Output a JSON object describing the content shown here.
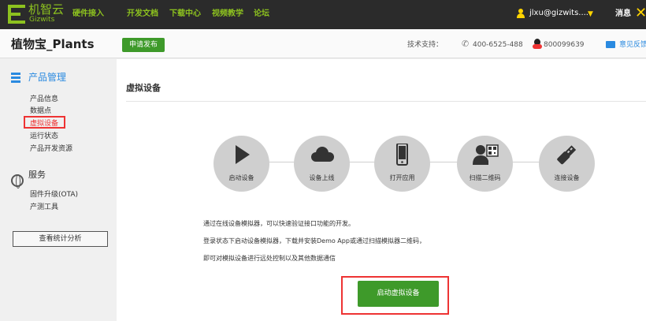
{
  "topbar": {
    "brand_cn": "机智云",
    "brand_en": "Gizwits",
    "nav": [
      "硬件接入",
      "开发文档",
      "下载中心",
      "视频教学",
      "论坛"
    ],
    "user": "jlxu@gizwits....",
    "messages": "消息",
    "accent_color": "#8dc21f"
  },
  "subbar": {
    "product_name": "植物宝_Plants",
    "publish_label": "申请发布",
    "support_label": "技术支持：",
    "phone": "400-6525-488",
    "qq": "800099639",
    "feedback": "意见反馈"
  },
  "sidebar": {
    "section1": "产品管理",
    "items1": [
      "产品信息",
      "数据点",
      "虚拟设备",
      "运行状态",
      "产品开发资源"
    ],
    "active_index": 2,
    "section2": "服务",
    "items2": [
      "固件升级(OTA)",
      "产测工具"
    ],
    "stats_button": "查看统计分析"
  },
  "main": {
    "title": "虚拟设备",
    "steps": [
      {
        "label": "启动设备",
        "icon": "play-icon"
      },
      {
        "label": "设备上线",
        "icon": "cloud-icon"
      },
      {
        "label": "打开应用",
        "icon": "phone-icon"
      },
      {
        "label": "扫描二维码",
        "icon": "scan-qr-icon"
      },
      {
        "label": "连接设备",
        "icon": "link-icon"
      }
    ],
    "desc": [
      "通过在线设备模拟器，可以快速验证接口功能的开发。",
      "登录状态下启动设备模拟器，下载并安装Demo App或通过扫描模拟器二维码，",
      "即可对模拟设备进行远处控制以及其他数据通信"
    ],
    "start_button": "启动虚拟设备",
    "highlight_color": "#e33333",
    "button_color": "#3e9a2a"
  }
}
